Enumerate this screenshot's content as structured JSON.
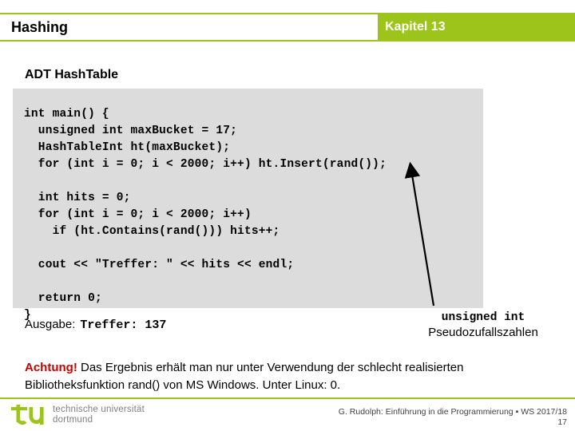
{
  "header": {
    "title": "Hashing",
    "chapter": "Kapitel 13",
    "accent_color": "#9DC41A"
  },
  "subtitle": "ADT HashTable",
  "code": {
    "language": "cpp",
    "background_color": "#DCDCDC",
    "text": "int main() {\n  unsigned int maxBucket = 17;\n  HashTableInt ht(maxBucket);\n  for (int i = 0; i < 2000; i++) ht.Insert(rand());\n\n  int hits = 0;\n  for (int i = 0; i < 2000; i++)\n    if (ht.Contains(rand())) hits++;\n\n  cout << \"Treffer: \" << hits << endl;\n\n  return 0;\n}"
  },
  "annotation": {
    "line1": "unsigned int",
    "line2": "Pseudozufallszahlen",
    "arrow": "callout-arrow"
  },
  "output": {
    "label": "Ausgabe:",
    "value": "Treffer: 137"
  },
  "warning": {
    "lead": "Achtung!",
    "lead_color": "#CC0000",
    "text": " Das Ergebnis erhält man nur unter Verwendung der schlecht realisierten Bibliotheksfunktion rand() von MS Windows. Unter Linux: 0."
  },
  "footer": {
    "logo_mark": "tu",
    "logo_line1": "technische universität",
    "logo_line2": "dortmund",
    "credit": "G. Rudolph: Einführung in die Programmierung ▪ WS 2017/18",
    "page": "17"
  }
}
